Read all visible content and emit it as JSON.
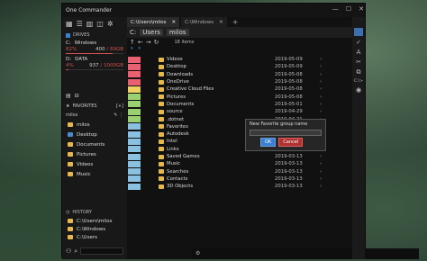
{
  "title": "One Commander",
  "window_controls": {
    "minimize": "—",
    "maximize": "☐",
    "close": "✕"
  },
  "drives_label": "DRIVES",
  "drives": [
    {
      "letter": "C:",
      "name": "Windows",
      "pct": "82%",
      "free": "400",
      "cap": "/ 89GB",
      "fill": 0.82
    },
    {
      "letter": "D:",
      "name": "DATA",
      "pct": "4%",
      "free": "937",
      "cap": "/ 1000GB",
      "fill": 0.04
    }
  ],
  "favorites_label": "FAVORITES",
  "fav_add": "[+]",
  "fav_current": "milos",
  "favorites": [
    "milos",
    "Desktop",
    "Documents",
    "Pictures",
    "Videos",
    "Music"
  ],
  "history_label": "HISTORY",
  "history": [
    "C:\\Users\\milos",
    "C:\\Windows",
    "C:\\Users"
  ],
  "tabs": [
    {
      "label": "C:\\Users\\milos",
      "close": "✕"
    },
    {
      "label": "C:\\Windows",
      "close": "✕"
    },
    {
      "label": "+"
    }
  ],
  "path": {
    "drive": "C:",
    "segs": [
      "Users",
      "milos"
    ]
  },
  "item_count": "18 items",
  "files": [
    {
      "size": "",
      "name": "Videos",
      "date": "2019-05-09",
      "color": "#e96070",
      "arr": "›"
    },
    {
      "size": "",
      "name": "Desktop",
      "date": "2019-05-09",
      "color": "#e96070",
      "arr": "›"
    },
    {
      "size": "",
      "name": "Downloads",
      "date": "2019-05-08",
      "color": "#e96070",
      "arr": "›"
    },
    {
      "size": "",
      "name": "OneDrive",
      "date": "2019-05-08",
      "color": "#e96070",
      "arr": "›"
    },
    {
      "size": "",
      "name": "Creative Cloud Files",
      "date": "2019-05-08",
      "color": "#f0d060",
      "arr": "›"
    },
    {
      "size": "",
      "name": "Pictures",
      "date": "2019-05-08",
      "color": "#9ad070",
      "arr": "›"
    },
    {
      "size": "",
      "name": "Documents",
      "date": "2019-05-01",
      "color": "#9ad070",
      "arr": "›"
    },
    {
      "size": "",
      "name": "source",
      "date": "2019-04-29",
      "color": "#9ad070",
      "arr": "›"
    },
    {
      "size": "",
      "name": ".dotnet",
      "date": "2019-04-21",
      "color": "#9ad070",
      "arr": "›"
    },
    {
      "size": "",
      "name": "Favorites",
      "date": "",
      "color": "#8ac0e0",
      "arr": "›"
    },
    {
      "size": "",
      "name": "Autodesk",
      "date": "",
      "color": "#8ac0e0",
      "arr": "›"
    },
    {
      "size": "",
      "name": "Intel",
      "date": "",
      "color": "#8ac0e0",
      "arr": "›"
    },
    {
      "size": "",
      "name": "Links",
      "date": "2019-03-13",
      "color": "#8ac0e0",
      "arr": "›"
    },
    {
      "size": "",
      "name": "Saved Games",
      "date": "2019-03-13",
      "color": "#8ac0e0",
      "arr": "›"
    },
    {
      "size": "",
      "name": "Music",
      "date": "2019-03-13",
      "color": "#8ac0e0",
      "arr": "›"
    },
    {
      "size": "",
      "name": "Searches",
      "date": "2019-03-13",
      "color": "#8ac0e0",
      "arr": "›"
    },
    {
      "size": "",
      "name": "Contacts",
      "date": "2019-03-13",
      "color": "#8ac0e0",
      "arr": "›"
    },
    {
      "size": "",
      "name": "3D Objects",
      "date": "2019-03-13",
      "color": "#8ac0e0",
      "arr": "›"
    }
  ],
  "dialog": {
    "label": "New Favorite group name",
    "ok": "OK",
    "cancel": "Cancel"
  },
  "right_bar": [
    "✓",
    "A",
    "✂",
    "⧉",
    "C:\\>"
  ]
}
